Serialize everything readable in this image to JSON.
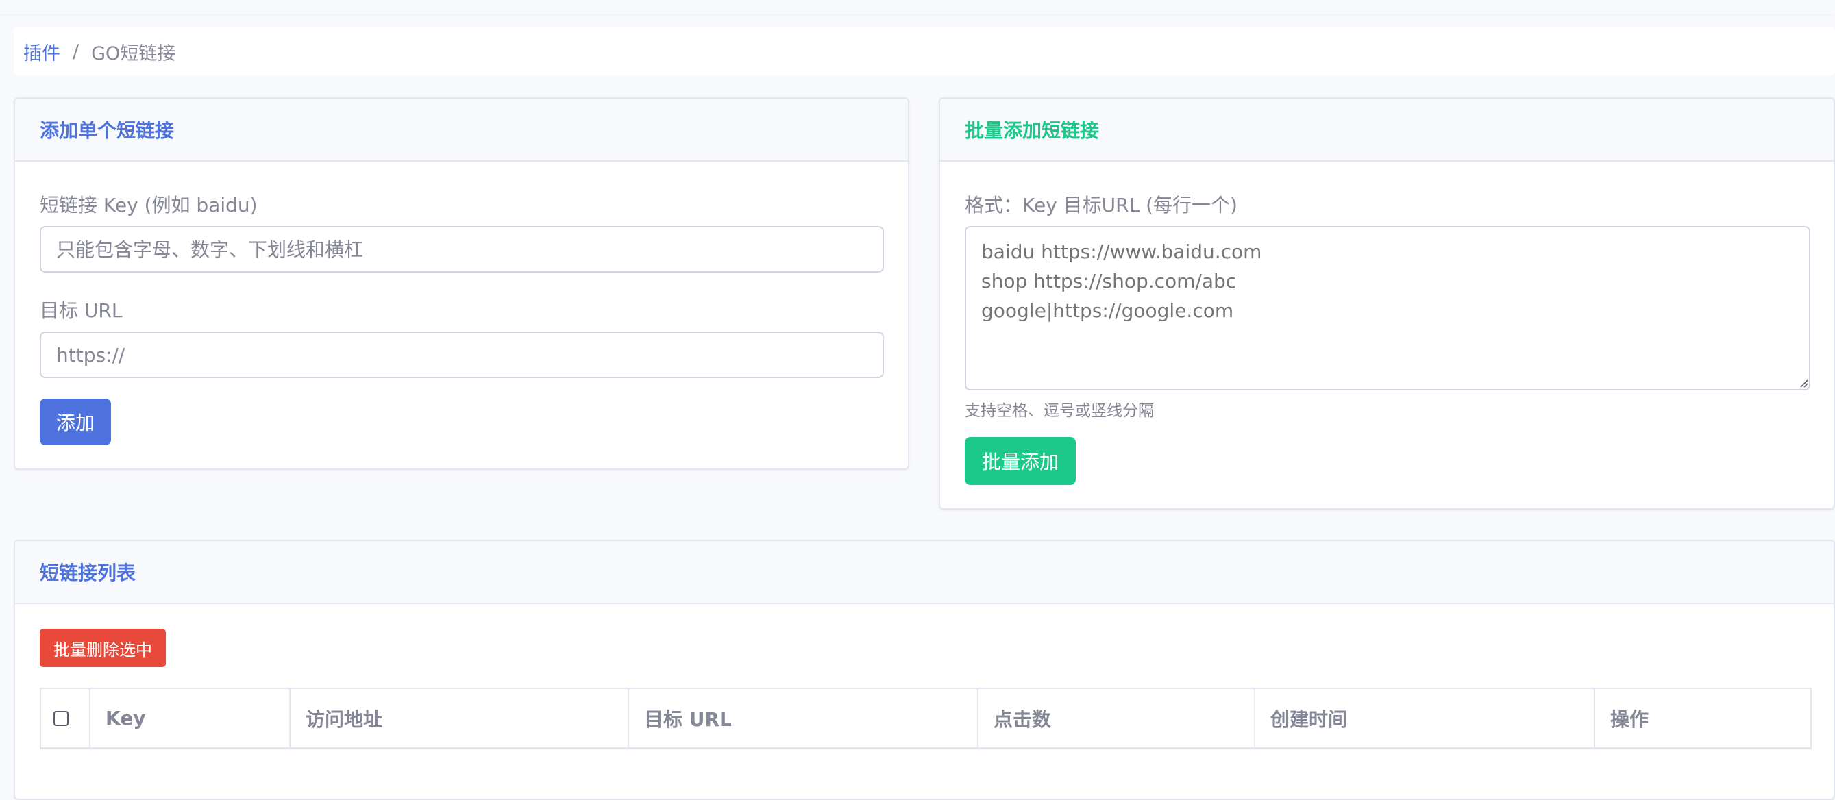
{
  "breadcrumb": {
    "parent": "插件",
    "separator": "/",
    "current": "GO短链接"
  },
  "single_card": {
    "title": "添加单个短链接",
    "key_label": "短链接 Key (例如 baidu)",
    "key_placeholder": "只能包含字母、数字、下划线和横杠",
    "url_label": "目标 URL",
    "url_placeholder": "https://",
    "submit_label": "添加"
  },
  "batch_card": {
    "title": "批量添加短链接",
    "format_label": "格式：Key 目标URL (每行一个)",
    "textarea_placeholder": "baidu https://www.baidu.com\nshop https://shop.com/abc\ngoogle|https://google.com",
    "help_text": "支持空格、逗号或竖线分隔",
    "submit_label": "批量添加"
  },
  "list_card": {
    "title": "短链接列表",
    "bulk_delete_label": "批量删除选中",
    "columns": [
      "Key",
      "访问地址",
      "目标 URL",
      "点击数",
      "创建时间",
      "操作"
    ]
  },
  "colors": {
    "primary": "#4e73df",
    "success": "#1cc88a",
    "danger": "#e74a3b",
    "muted": "#858796",
    "border": "#e3e6f0"
  },
  "icons": {
    "select_all": "checkbox-unchecked",
    "textarea_resize": "resize-grip-icon"
  }
}
